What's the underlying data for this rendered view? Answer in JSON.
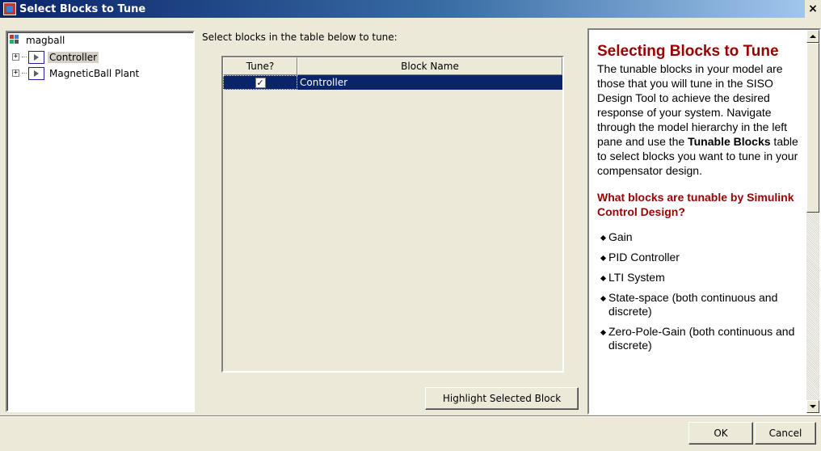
{
  "window": {
    "title": "Select Blocks to Tune",
    "close_symbol": "×"
  },
  "tree": {
    "root": {
      "label": "magball",
      "icon": "model-icon"
    },
    "children": [
      {
        "label": "Controller",
        "expander": "+",
        "icon": "subsystem-block-icon"
      },
      {
        "label": "MagneticBall Plant",
        "expander": "+",
        "icon": "subsystem-block-icon"
      }
    ]
  },
  "main": {
    "instruction": "Select blocks in the table below to tune:",
    "table": {
      "columns": [
        "Tune?",
        "Block Name"
      ],
      "rows": [
        {
          "tune": true,
          "tune_mark": "✓",
          "block_name": "Controller"
        }
      ]
    },
    "highlight_button": "Highlight Selected Block"
  },
  "help": {
    "title": "Selecting Blocks to Tune",
    "body_part1": "The tunable blocks in your model are those that you will tune in the SISO Design Tool to achieve the desired response of your system. Navigate through the model hierarchy in the left pane and use the ",
    "body_bold": "Tunable Blocks",
    "body_part2": " table to select blocks you want to tune in your compensator design.",
    "subtitle": "What blocks are tunable by Simulink Control Design?",
    "list": [
      "Gain",
      "PID Controller",
      "LTI System",
      "State-space (both continuous and discrete)",
      "Zero-Pole-Gain (both continuous and discrete)"
    ]
  },
  "buttons": {
    "ok": "OK",
    "cancel": "Cancel"
  },
  "colors": {
    "title_bar": "#0a246a",
    "selection": "#0a246a",
    "help_heading": "#990000",
    "dialog_bg": "#ece9d8"
  }
}
